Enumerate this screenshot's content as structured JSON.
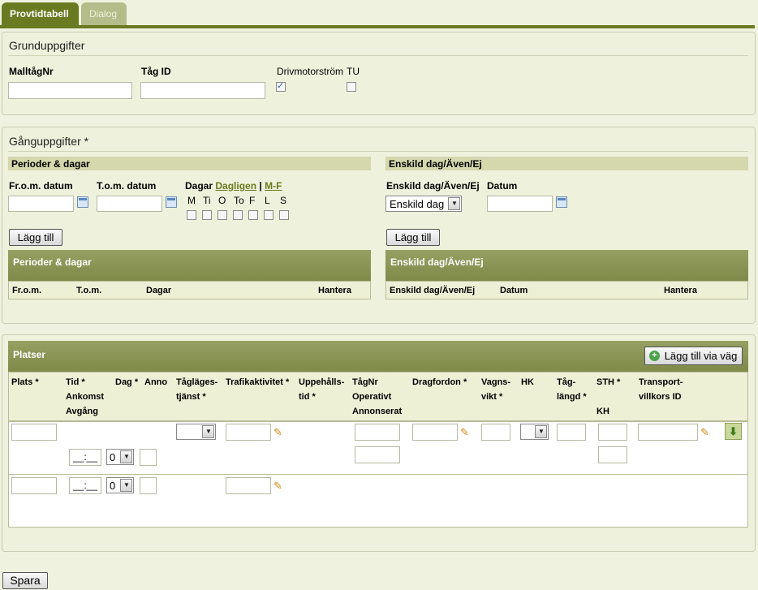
{
  "tabs": {
    "active": "Provtidtabell",
    "inactive": "Dialog"
  },
  "grund": {
    "title": "Grunduppgifter",
    "malltagnr": "MalltågNr",
    "tagid": "Tåg ID",
    "drivmotor": "Drivmotorström",
    "tu": "TU",
    "drivmotor_checked": true,
    "tu_checked": false
  },
  "gang": {
    "title": "Gånguppgifter *",
    "perioder_bar": "Perioder & dagar",
    "enskild_bar": "Enskild dag/Även/Ej",
    "from_label": "Fr.o.m. datum",
    "tom_label": "T.o.m. datum",
    "dagar_label": "Dagar",
    "dagligen": "Dagligen",
    "sep": "|",
    "mf": "M-F",
    "days": [
      "M",
      "Ti",
      "O",
      "To",
      "F",
      "L",
      "S"
    ],
    "enskild_label": "Enskild dag/Även/Ej",
    "datum_label": "Datum",
    "enskild_select": "Enskild dag",
    "add_button": "Lägg till",
    "left_grid": {
      "title": "Perioder & dagar",
      "cols": [
        "Fr.o.m.",
        "T.o.m.",
        "Dagar",
        "Hantera"
      ]
    },
    "right_grid": {
      "title": "Enskild dag/Även/Ej",
      "cols": [
        "Enskild dag/Även/Ej",
        "Datum",
        "Hantera"
      ]
    }
  },
  "platser": {
    "title": "Platser",
    "add_via": "Lägg till via väg",
    "cols": {
      "plats": "Plats *",
      "tid1": "Tid *",
      "tid2": "Ankomst",
      "tid3": "Avgång",
      "dag": "Dag *",
      "anno": "Anno",
      "taglage1": "Tågläges-",
      "taglage2": "tjänst *",
      "trafik": "Trafikaktivitet *",
      "uppeh1": "Uppehålls-",
      "uppeh2": "tid *",
      "tagnr1": "TågNr",
      "tagnr2": "Operativt",
      "tagnr3": "Annonserat",
      "dragfordon": "Dragfordon *",
      "vagns1": "Vagns-",
      "vagns2": "vikt *",
      "hk": "HK",
      "tag1": "Tåg-",
      "tag2": "längd *",
      "sth": "STH *",
      "kh": "KH",
      "transp1": "Transport-",
      "transp2": "villkors ID"
    },
    "time_placeholder": "__:__",
    "dag_value": "0"
  },
  "save_button": "Spara"
}
